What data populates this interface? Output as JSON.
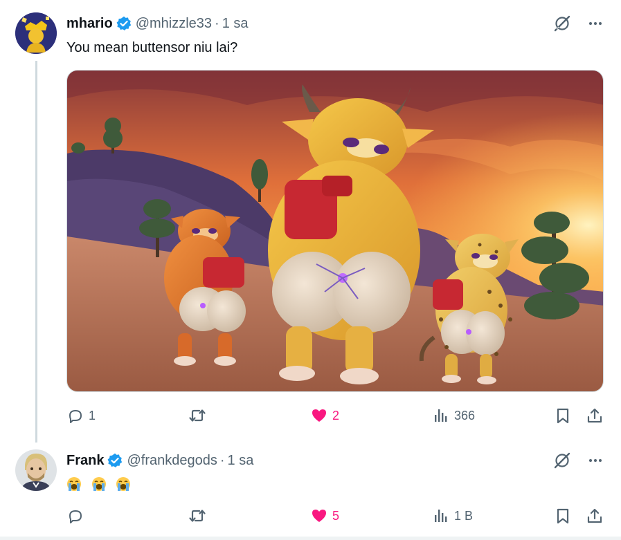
{
  "tweets": [
    {
      "name": "mhario",
      "handle": "@mhizzle33",
      "separator": "·",
      "time": "1 sa",
      "text": "You mean buttensor niu lai?",
      "stats": {
        "replies": "1",
        "retweets": "",
        "likes": "2",
        "views": "366"
      }
    },
    {
      "name": "Frank",
      "handle": "@frankdegods",
      "separator": "·",
      "time": "1 sa",
      "text": "",
      "emojis": [
        "loudly-crying-face-emoji",
        "loudly-crying-face-emoji",
        "loudly-crying-face-emoji"
      ],
      "stats": {
        "replies": "",
        "retweets": "",
        "likes": "5",
        "views": "1 B"
      }
    }
  ],
  "colors": {
    "accent": "#1d9bf0",
    "like": "#f91880",
    "muted": "#536471",
    "thread_line": "#cfd9de"
  },
  "icons": [
    "verified-badge-icon",
    "grok-icon",
    "more-icon",
    "reply-icon",
    "retweet-icon",
    "like-icon",
    "views-icon",
    "bookmark-icon",
    "share-icon"
  ]
}
